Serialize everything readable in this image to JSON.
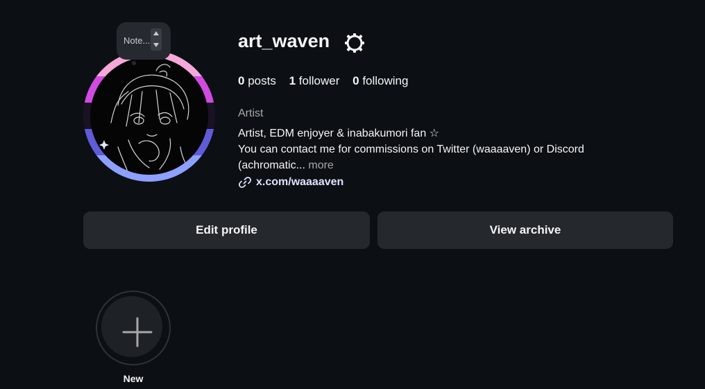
{
  "note": {
    "text": "Note..."
  },
  "profile": {
    "username": "art_waven",
    "stats": {
      "posts_count": "0",
      "posts_label": "posts",
      "followers_count": "1",
      "followers_label": "follower",
      "following_count": "0",
      "following_label": "following"
    },
    "category": "Artist",
    "bio_line1": "Artist, EDM enjoyer & inabakumori fan ☆",
    "bio_line2": "You can contact me for commissions on Twitter (waaaaven) or Discord",
    "bio_line3": "(achromatic...",
    "more_label": "more",
    "link": "x.com/waaaaven"
  },
  "actions": {
    "edit_profile": "Edit profile",
    "view_archive": "View archive"
  },
  "highlights": {
    "new_label": "New"
  },
  "icons": {
    "settings": "settings-gear-icon",
    "link": "link-icon",
    "plus": "plus-icon",
    "note_stepper_up": "caret-up-icon",
    "note_stepper_down": "caret-down-icon"
  },
  "colors": {
    "background": "#0c1014",
    "button": "#25292e",
    "text": "#f5f5f5",
    "muted": "#a8a8a8",
    "link": "#e0e1ff",
    "ring_pink": "#f5a9d9",
    "ring_magenta": "#d14be2",
    "ring_dark": "#1a1124",
    "ring_violet": "#5f5bd9",
    "ring_periwinkle": "#8ea0ff"
  }
}
